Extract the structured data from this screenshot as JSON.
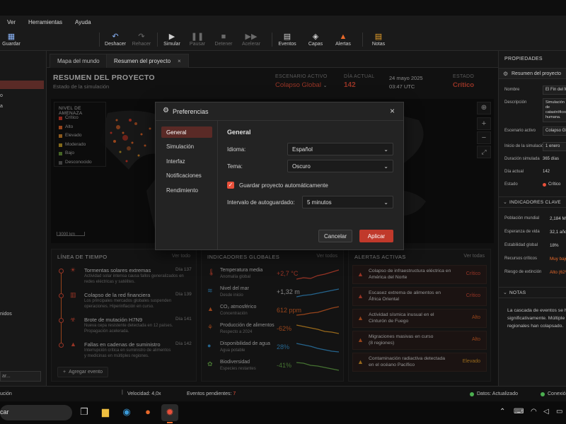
{
  "menu": [
    "Ver",
    "Herramientas",
    "Ayuda"
  ],
  "toolbar": {
    "save": "Guardar",
    "undo": "Deshacer",
    "redo": "Rehacer",
    "simulate": "Simular",
    "pause": "Pausar",
    "stop": "Detener",
    "speed_up": "Acelerar",
    "events": "Eventos",
    "layers": "Capas",
    "alerts": "Alertas",
    "notes": "Notas"
  },
  "tabs": [
    "Mapa del mundo",
    "Resumen del proyecto"
  ],
  "project": {
    "title": "RESUMEN DEL PROYECTO",
    "subtitle": "Estado de la simulación",
    "scenario_label": "ESCENARIO ACTIVO",
    "scenario_value": "Colapso Global",
    "day_label": "DÍA ACTUAL",
    "day_value": "142",
    "date": "24 mayo 2025",
    "time": "03:47 UTC",
    "state_label": "ESTADO",
    "state_value": "Crítico"
  },
  "threat_legend": {
    "title": "NIVEL DE AMENAZA",
    "items": [
      {
        "label": "Crítico",
        "color": "#e03b2a"
      },
      {
        "label": "Alto",
        "color": "#e8692a"
      },
      {
        "label": "Elevado",
        "color": "#d98a2b"
      },
      {
        "label": "Moderado",
        "color": "#c9a227"
      },
      {
        "label": "Bajo",
        "color": "#6a9a3a"
      },
      {
        "label": "Desconocido",
        "color": "#666666"
      }
    ]
  },
  "map": {
    "scale": "3000 km"
  },
  "timeline": {
    "title": "LÍNEA DE TIEMPO",
    "link": "Ver todo",
    "add": "Agregar evento",
    "events": [
      {
        "title": "Tormentas solares extremas",
        "day": "Día 137",
        "desc1": "Actividad solar intensa causa fallos generalizados en",
        "desc2": "redes eléctricas y satélites."
      },
      {
        "title": "Colapso de la red financiera",
        "day": "Día 139",
        "desc1": "Los principales mercados globales suspenden",
        "desc2": "operaciones. Hiperinflación en curso."
      },
      {
        "title": "Brote de mutación H7N9",
        "day": "Día 141",
        "desc1": "Nueva cepa resistente detectada en 12 países.",
        "desc2": "Propagación acelerada."
      },
      {
        "title": "Fallas en cadenas de suministro",
        "day": "Día 142",
        "desc1": "Interrupción crítica en suministro de alimentos",
        "desc2": "y medicinas en múltiples regiones."
      }
    ]
  },
  "indicators": {
    "title": "INDICADORES GLOBALES",
    "link": "Ver todos",
    "rows": [
      {
        "name": "Temperatura media",
        "sub": "Anomalía global",
        "value": "+2,7 °C",
        "color": "#e8503a"
      },
      {
        "name": "Nivel del mar",
        "sub": "Desde inicio",
        "value": "+1,32 m",
        "color": "#cfcfcf"
      },
      {
        "name": "CO₂ atmosférico",
        "sub": "Concentración",
        "value": "612 ppm",
        "color": "#e8692a"
      },
      {
        "name": "Producción de alimentos",
        "sub": "Respecto a 2024",
        "value": "-62%",
        "color": "#e8692a"
      },
      {
        "name": "Disponibilidad de agua",
        "sub": "Agua potable",
        "value": "28%",
        "color": "#3a9ad9"
      },
      {
        "name": "Biodiversidad",
        "sub": "Especies restantes",
        "value": "-41%",
        "color": "#6ab04c"
      }
    ]
  },
  "alerts": {
    "title": "ALERTAS ACTIVAS",
    "link": "Ver todas",
    "items": [
      {
        "text1": "Colapso de infraestructura eléctrica en",
        "text2": "América del Norte",
        "level": "Crítico"
      },
      {
        "text1": "Escasez extrema de alimentos en",
        "text2": "África Oriental",
        "level": "Crítico"
      },
      {
        "text1": "Actividad sísmica inusual en el",
        "text2": "Cinturón de Fuego",
        "level": "Alto"
      },
      {
        "text1": "Migraciones masivas en curso",
        "text2": "(8 regiones)",
        "level": "Alto"
      },
      {
        "text1": "Contaminación radiactiva detectada",
        "text2": "en el océano Pacífico",
        "level": "Elevado"
      }
    ]
  },
  "properties": {
    "title": "PROPIEDADES",
    "item": "Resumen del proyecto",
    "rows": [
      {
        "label": "Nombre",
        "value": "El Fin del Mundo"
      },
      {
        "label": "Descripción",
        "value": "Simulación de catastróficos humana."
      },
      {
        "label": "Escenario activo",
        "value": "Colapso Global"
      },
      {
        "label": "Inicio de la simulación",
        "value": "1 enero"
      },
      {
        "label": "Duración simulada",
        "value": "365 días"
      },
      {
        "label": "Día actual",
        "value": "142"
      },
      {
        "label": "Estado",
        "value": "Crítico"
      }
    ]
  },
  "key_indicators": {
    "title": "INDICADORES CLAVE",
    "rows": [
      {
        "label": "Población mundial",
        "value": "2,184 M"
      },
      {
        "label": "Esperanza de vida",
        "value": "32,1 años"
      },
      {
        "label": "Estabilidad global",
        "value": "18%"
      },
      {
        "label": "Recursos críticos",
        "value": "Muy bajo"
      },
      {
        "label": "Riesgo de extinción",
        "value": "Alto (62%)"
      }
    ]
  },
  "notes": {
    "title": "NOTAS",
    "text1": "La cascada de eventos se h",
    "text2": "significativamente. Múltiple",
    "text3": "regionales han colapsado."
  },
  "left_panel": {
    "f1": "o",
    "f2": "a",
    "f3": "nidos",
    "f4": "ar..."
  },
  "status": {
    "left": "ución",
    "speed": "Velocidad: 4,0x",
    "pending_label": "Eventos pendientes:",
    "pending": "7",
    "data": "Datos: Actualizado",
    "conn": "Conexió"
  },
  "taskbar": {
    "search": "car"
  },
  "dialog": {
    "title": "Preferencias",
    "nav": [
      "General",
      "Simulación",
      "Interfaz",
      "Notificaciones",
      "Rendimiento"
    ],
    "section": "General",
    "language_label": "Idioma:",
    "language_value": "Español",
    "theme_label": "Tema:",
    "theme_value": "Oscuro",
    "autosave_label": "Guardar proyecto automáticamente",
    "interval_label": "Intervalo de autoguardado:",
    "interval_value": "5 minutos",
    "cancel": "Cancelar",
    "apply": "Aplicar"
  },
  "colors": {
    "accent": "#e8503a",
    "apply": "#c0392b",
    "warn": "#e8692a"
  }
}
